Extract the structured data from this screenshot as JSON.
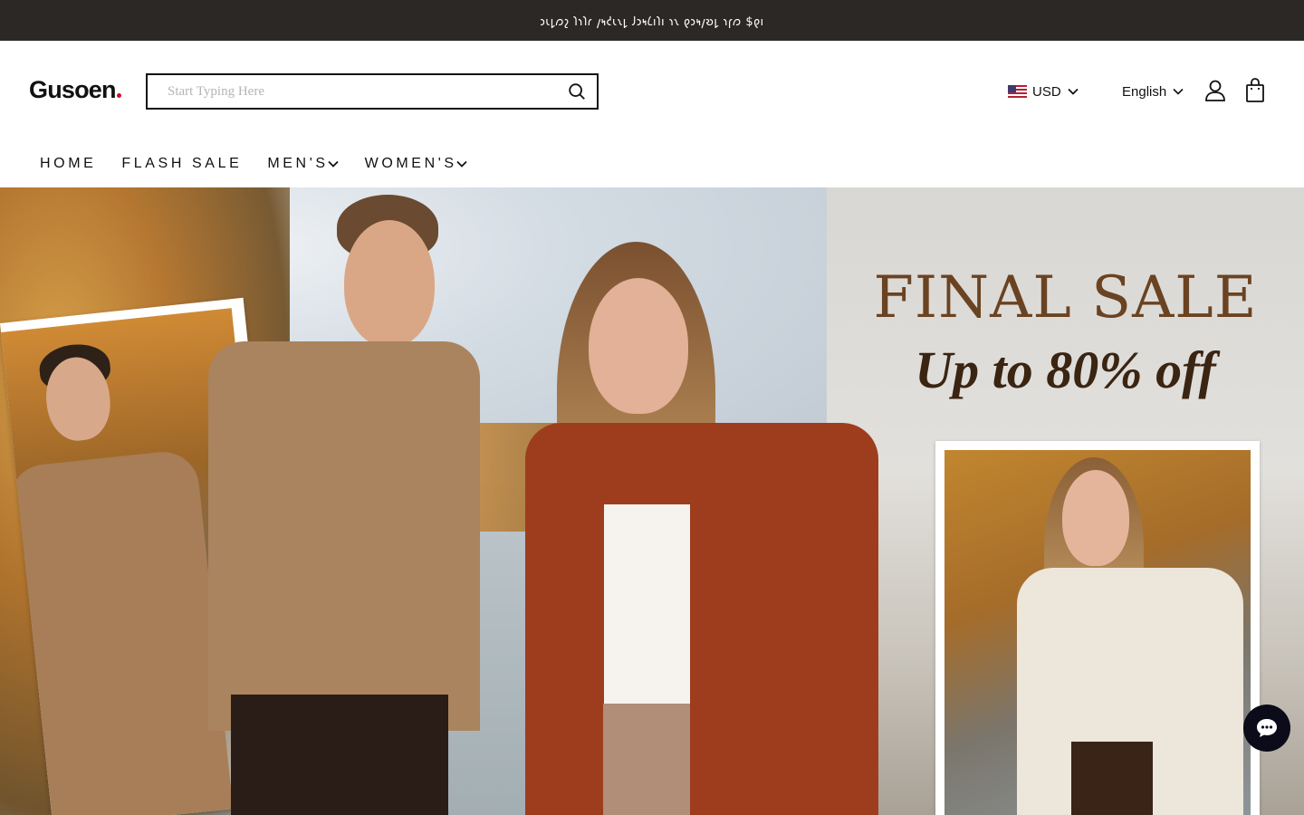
{
  "announcement": {
    "text": "𐑮𐑧𐑛𐑼𐑟 𐑐𐑪𐑐𐑩 𐑢𐑰𐑒𐑧𐑯𐑛 𐑓𐑮𐑰𐑖𐑦𐑐𐑦 𐑪𐑯 𐑞𐑮𐑰𐑢𐑹𐑛 𐑪𐑝𐑼 $𐑞𐑦"
  },
  "header": {
    "logo_text": "Gusoen",
    "search": {
      "placeholder": "Start Typing Here",
      "value": ""
    },
    "currency": {
      "label": "USD",
      "flag_icon": "us-flag-icon"
    },
    "language": {
      "label": "English"
    },
    "icons": {
      "account": "user-icon",
      "cart": "shopping-bag-icon",
      "search": "search-icon"
    }
  },
  "nav": {
    "items": [
      {
        "label": "HOME",
        "has_dropdown": false
      },
      {
        "label": "FLASH SALE",
        "has_dropdown": false
      },
      {
        "label": "MEN'S",
        "has_dropdown": true
      },
      {
        "label": "WOMEN'S",
        "has_dropdown": true
      }
    ]
  },
  "hero": {
    "title": "FINAL SALE",
    "subtitle": "Up to 80% off"
  },
  "chat": {
    "icon": "chat-bubble-icon"
  },
  "colors": {
    "announce_bg": "#2b2826",
    "title_brown": "#6a4322",
    "subtitle_brown": "#3a2412",
    "chat_bg": "#0b0b1a",
    "logo_dot": "#c8102e"
  }
}
